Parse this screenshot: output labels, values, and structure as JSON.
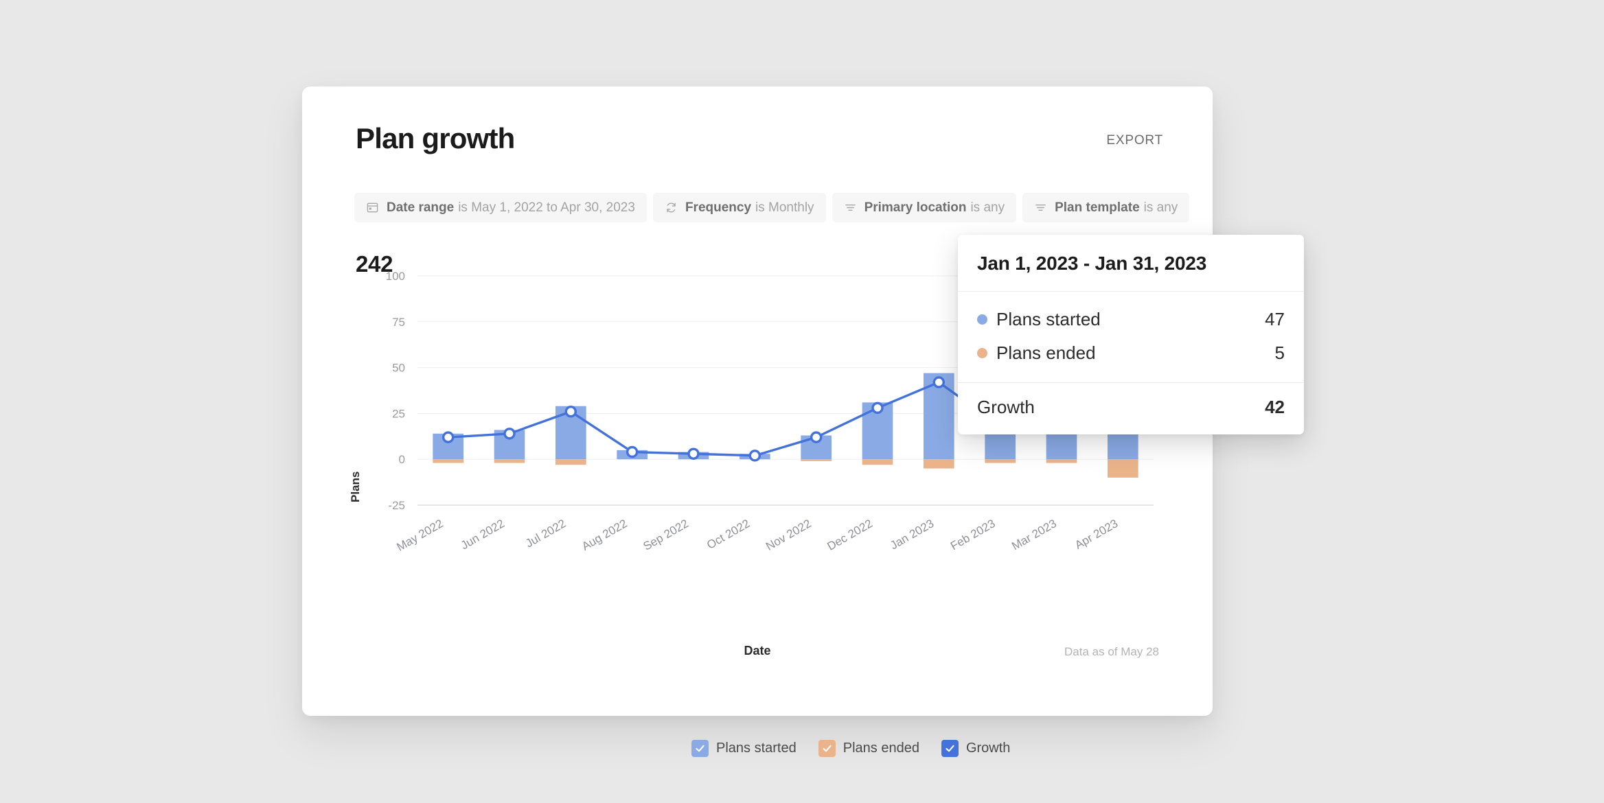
{
  "header": {
    "title": "Plan growth",
    "export_label": "EXPORT"
  },
  "filters": [
    {
      "icon": "calendar-icon",
      "label": "Date range",
      "value": "is May 1, 2022 to Apr 30, 2023"
    },
    {
      "icon": "refresh-icon",
      "label": "Frequency",
      "value": "is Monthly"
    },
    {
      "icon": "filter-icon",
      "label": "Primary location",
      "value": "is any"
    },
    {
      "icon": "filter-icon",
      "label": "Plan template",
      "value": "is any"
    }
  ],
  "summary": {
    "total": "242"
  },
  "footnote": "Data as of May 28",
  "legend": [
    {
      "label": "Plans started",
      "color": "#8aaae5",
      "checked": true
    },
    {
      "label": "Plans ended",
      "color": "#eab38a",
      "checked": true
    },
    {
      "label": "Growth",
      "color": "#4372db",
      "checked": true
    }
  ],
  "tooltip": {
    "title": "Jan 1, 2023 - Jan 31, 2023",
    "rows": [
      {
        "label": "Plans started",
        "value": "47",
        "color": "#8aaae5"
      },
      {
        "label": "Plans ended",
        "value": "5",
        "color": "#eab38a"
      }
    ],
    "total_label": "Growth",
    "total_value": "42"
  },
  "chart_data": {
    "type": "bar",
    "title": "Plan growth",
    "xlabel": "Date",
    "ylabel": "Plans",
    "ylim": [
      -25,
      100
    ],
    "yticks": [
      100,
      75,
      50,
      25,
      0,
      -25
    ],
    "grid": true,
    "legend_position": "bottom",
    "categories": [
      "May 2022",
      "Jun 2022",
      "Jul 2022",
      "Aug 2022",
      "Sep 2022",
      "Oct 2022",
      "Nov 2022",
      "Dec 2022",
      "Jan 2023",
      "Feb 2023",
      "Mar 2023",
      "Apr 2023"
    ],
    "series": [
      {
        "name": "Plans started",
        "type": "bar",
        "color": "#8aaae5",
        "values": [
          14,
          16,
          29,
          5,
          4,
          3,
          13,
          31,
          47,
          20,
          22,
          29
        ]
      },
      {
        "name": "Plans ended",
        "type": "bar",
        "color": "#eab38a",
        "values": [
          -2,
          -2,
          -3,
          0,
          0,
          0,
          -1,
          -3,
          -5,
          -2,
          -2,
          -10
        ]
      },
      {
        "name": "Growth",
        "type": "line",
        "color": "#4372db",
        "values": [
          12,
          14,
          26,
          4,
          3,
          2,
          12,
          28,
          42,
          18,
          20,
          19
        ]
      }
    ]
  }
}
